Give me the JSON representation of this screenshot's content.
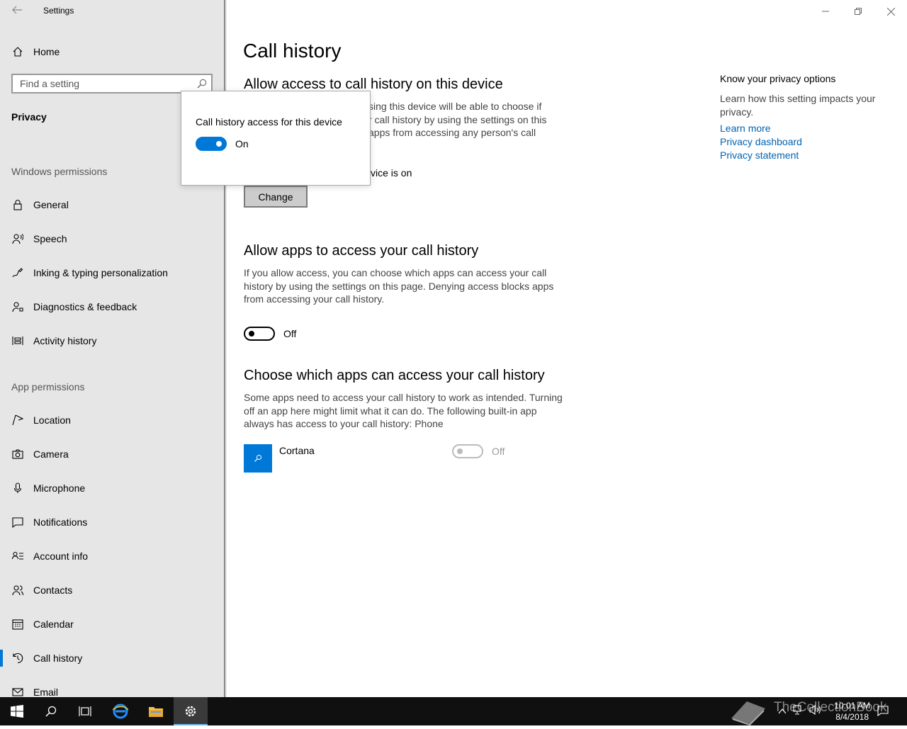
{
  "window": {
    "title": "Settings"
  },
  "sidebar": {
    "home_label": "Home",
    "search_placeholder": "Find a setting",
    "section_title": "Privacy",
    "windows_permissions_header": "Windows permissions",
    "windows_permissions": [
      {
        "label": "General",
        "icon": "lock-icon"
      },
      {
        "label": "Speech",
        "icon": "speech-icon"
      },
      {
        "label": "Inking & typing personalization",
        "icon": "inking-icon"
      },
      {
        "label": "Diagnostics & feedback",
        "icon": "diagnostics-icon"
      },
      {
        "label": "Activity history",
        "icon": "activity-history-icon"
      }
    ],
    "app_permissions_header": "App permissions",
    "app_permissions": [
      {
        "label": "Location",
        "icon": "location-icon"
      },
      {
        "label": "Camera",
        "icon": "camera-icon"
      },
      {
        "label": "Microphone",
        "icon": "microphone-icon"
      },
      {
        "label": "Notifications",
        "icon": "notifications-icon"
      },
      {
        "label": "Account info",
        "icon": "account-info-icon"
      },
      {
        "label": "Contacts",
        "icon": "contacts-icon"
      },
      {
        "label": "Calendar",
        "icon": "calendar-icon"
      },
      {
        "label": "Call history",
        "icon": "call-history-icon",
        "selected": true
      },
      {
        "label": "Email",
        "icon": "email-icon"
      }
    ]
  },
  "main": {
    "title": "Call history",
    "section1": {
      "heading": "Allow access to call history on this device",
      "desc_line1": "sing this device will be able to choose if",
      "desc_line2": "r call history by using the settings on this",
      "desc_line3": "apps from accessing any person's call",
      "status": "vice is on",
      "change_button": "Change"
    },
    "section2": {
      "heading": "Allow apps to access your call history",
      "desc": "If you allow access, you can choose which apps can access your call history by using the settings on this page. Denying access blocks apps from accessing your call history.",
      "toggle_label": "Off",
      "toggle_on": false
    },
    "section3": {
      "heading": "Choose which apps can access your call history",
      "desc": "Some apps need to access your call history to work as intended. Turning off an app here might limit what it can do. The following built-in app always has access to your call history: Phone",
      "apps": [
        {
          "name": "Cortana",
          "toggle_label": "Off",
          "enabled": false,
          "icon": "cortana-icon"
        }
      ]
    },
    "aside": {
      "heading": "Know your privacy options",
      "desc": "Learn how this setting impacts your privacy.",
      "links": [
        "Learn more",
        "Privacy dashboard",
        "Privacy statement"
      ]
    }
  },
  "flyout": {
    "title": "Call history access for this device",
    "toggle_label": "On",
    "toggle_on": true
  },
  "taskbar": {
    "time": "10:01 AM",
    "date": "8/4/2018",
    "watermark": "TheCollectionBook",
    "apps": [
      "start-icon",
      "search-icon",
      "task-view-icon",
      "edge-icon",
      "file-explorer-icon",
      "settings-icon"
    ]
  },
  "colors": {
    "accent": "#0078d7",
    "link": "#0063b1",
    "sidebar_bg": "#e6e6e6",
    "taskbar_bg": "#101010"
  }
}
